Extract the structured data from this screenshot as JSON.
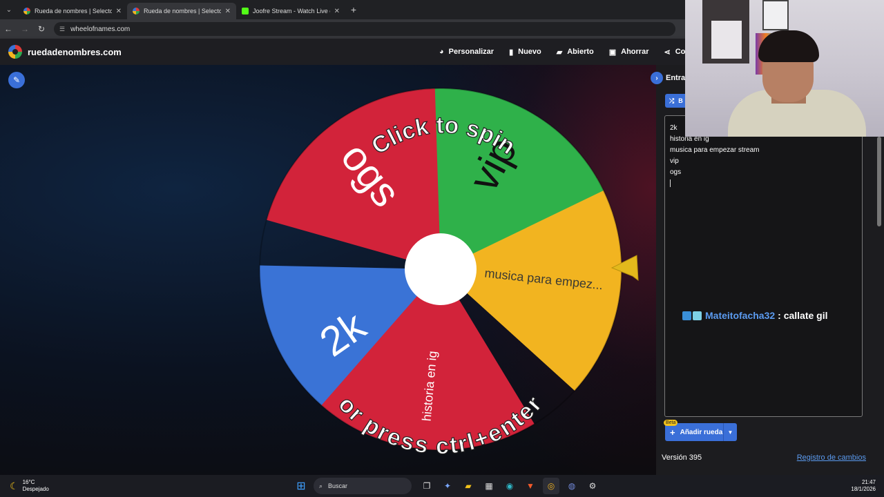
{
  "browser": {
    "tabs": [
      {
        "title": "Rueda de nombres | Selector de",
        "active": false
      },
      {
        "title": "Rueda de nombres | Selector de",
        "active": true
      },
      {
        "title": "Joofre Stream - Watch Live on Ki",
        "active": false
      }
    ],
    "url": "wheelofnames.com"
  },
  "app": {
    "site_name": "ruedadenombres.com",
    "menu": {
      "customize": "Personalizar",
      "new": "Nuevo",
      "open": "Abierto",
      "save": "Ahorrar",
      "share": "Co"
    }
  },
  "wheel": {
    "segments": [
      {
        "label": "2k",
        "color": "#3a73d6"
      },
      {
        "label": "historia en ig",
        "color": "#d2233a"
      },
      {
        "label": "musica para empez...",
        "color": "#f2b420"
      },
      {
        "label": "vip",
        "color": "#2fb14a"
      },
      {
        "label": "ogs",
        "color": "#d2233a"
      }
    ],
    "prompt_top": "Click to spin",
    "prompt_bottom": "or press ctrl+enter"
  },
  "panel": {
    "header": "Entrad",
    "shuffle_label": "B",
    "entries": [
      "2k",
      "historia en ig",
      "musica para empezar stream",
      "vip",
      "ogs"
    ],
    "add_wheel_label": "Añadir rueda",
    "beta_label": "Beta",
    "version": "Versión 395",
    "changelog": "Registro de cambios"
  },
  "chat": {
    "user": "Mateitofacha32",
    "message": ": callate gil"
  },
  "taskbar": {
    "temperature": "16°C",
    "weather": "Despejado",
    "search_placeholder": "Buscar",
    "time": "21:47",
    "date": "18/1/2026"
  }
}
